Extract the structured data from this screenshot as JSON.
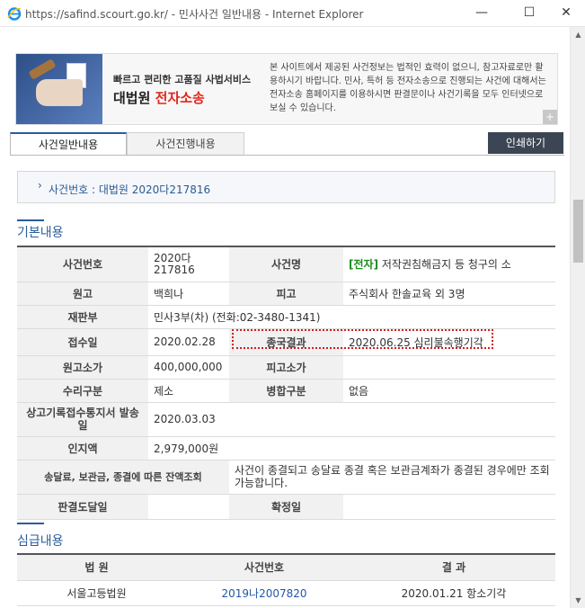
{
  "window": {
    "url": "https://safind.scourt.go.kr/",
    "separator": " - ",
    "page_title": "민사사건 일반내용 - Internet Explorer"
  },
  "banner": {
    "line1": "빠르고 편리한 고품질 사법서비스",
    "brand": "대법원",
    "brand_red": "전자소송",
    "description": "본 사이트에서 제공된 사건정보는 법적인 효력이 없으니, 참고자료로만 활용하시기 바랍니다. 민사, 특허 등 전자소송으로 진행되는 사건에 대해서는 전자소송 홈페이지를 이용하시면 판결문이나 사건기록을 모두 인터넷으로 보실 수 있습니다.",
    "plus": "+"
  },
  "tabs": [
    {
      "label": "사건일반내용",
      "active": true
    },
    {
      "label": "사건진행내용",
      "active": false
    }
  ],
  "print_label": "인쇄하기",
  "case_number_line": "사건번호 : 대법원 2020다217816",
  "basic_section": {
    "title": "기본내용",
    "rows": [
      {
        "l1": "사건번호",
        "v1": "2020다 217816",
        "l2": "사건명",
        "v2_tag": "[전자]",
        "v2": " 저작권침해금지 등 청구의 소"
      },
      {
        "l1": "원고",
        "v1": "백희나",
        "l2": "피고",
        "v2": "주식회사 한솔교육 외 3명"
      },
      {
        "l1": "재판부",
        "v1": "민사3부(차) (전화:02-3480-1341)"
      },
      {
        "l1": "접수일",
        "v1": "2020.02.28",
        "l2": "종국결과",
        "v2": "2020.06.25 심리불속행기각"
      },
      {
        "l1": "원고소가",
        "v1": "400,000,000",
        "l2": "피고소가",
        "v2": ""
      },
      {
        "l1": "수리구분",
        "v1": "제소",
        "l2": "병합구분",
        "v2": "없음"
      },
      {
        "l1": "상고기록접수통지서 발송일",
        "v1": "2020.03.03"
      },
      {
        "l1": "인지액",
        "v1": "2,979,000원"
      },
      {
        "l1": "송달료, 보관금, 종결에 따른 잔액조회",
        "v1": "사건이 종결되고 송달료 종결 혹은 보관금계좌가 종결된 경우에만 조회 가능합니다."
      },
      {
        "l1": "판결도달일",
        "v1": "",
        "l2": "확정일",
        "v2": ""
      }
    ]
  },
  "appeal_section": {
    "title": "심급내용",
    "headers": [
      "법 원",
      "사건번호",
      "결 과"
    ],
    "rows": [
      {
        "court": "서울고등법원",
        "case": "2019나2007820",
        "result": "2020.01.21 항소기각"
      }
    ]
  },
  "icons": {
    "browser": "internet-explorer-icon",
    "minimize": "minimize-icon",
    "maximize": "maximize-icon",
    "close": "close-icon"
  }
}
